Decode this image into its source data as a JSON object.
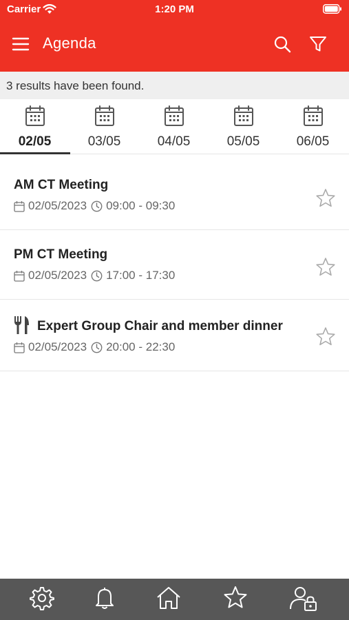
{
  "status_bar": {
    "carrier": "Carrier",
    "time": "1:20 PM"
  },
  "app_bar": {
    "title": "Agenda",
    "menu_icon": "hamburger-menu-icon",
    "search_icon": "search-icon",
    "filter_icon": "filter-icon"
  },
  "results": {
    "text": "3 results have been found."
  },
  "date_tabs": [
    {
      "label": "02/05",
      "active": true
    },
    {
      "label": "03/05",
      "active": false
    },
    {
      "label": "04/05",
      "active": false
    },
    {
      "label": "05/05",
      "active": false
    },
    {
      "label": "06/05",
      "active": false
    }
  ],
  "sessions": [
    {
      "title": "AM CT Meeting",
      "date": "02/05/2023",
      "time": "09:00 - 09:30",
      "icon": null,
      "favorite": false
    },
    {
      "title": "PM CT Meeting",
      "date": "02/05/2023",
      "time": "17:00 - 17:30",
      "icon": null,
      "favorite": false
    },
    {
      "title": "Expert Group Chair and member dinner",
      "date": "02/05/2023",
      "time": "20:00 - 22:30",
      "icon": "fork-knife-icon",
      "favorite": false
    }
  ],
  "bottom_nav": [
    "settings-icon",
    "bell-icon",
    "home-icon",
    "star-icon",
    "user-lock-icon"
  ],
  "colors": {
    "header_red": "#ee3124",
    "bottom_nav_gray": "#575757",
    "results_bar_gray": "#efefef"
  }
}
